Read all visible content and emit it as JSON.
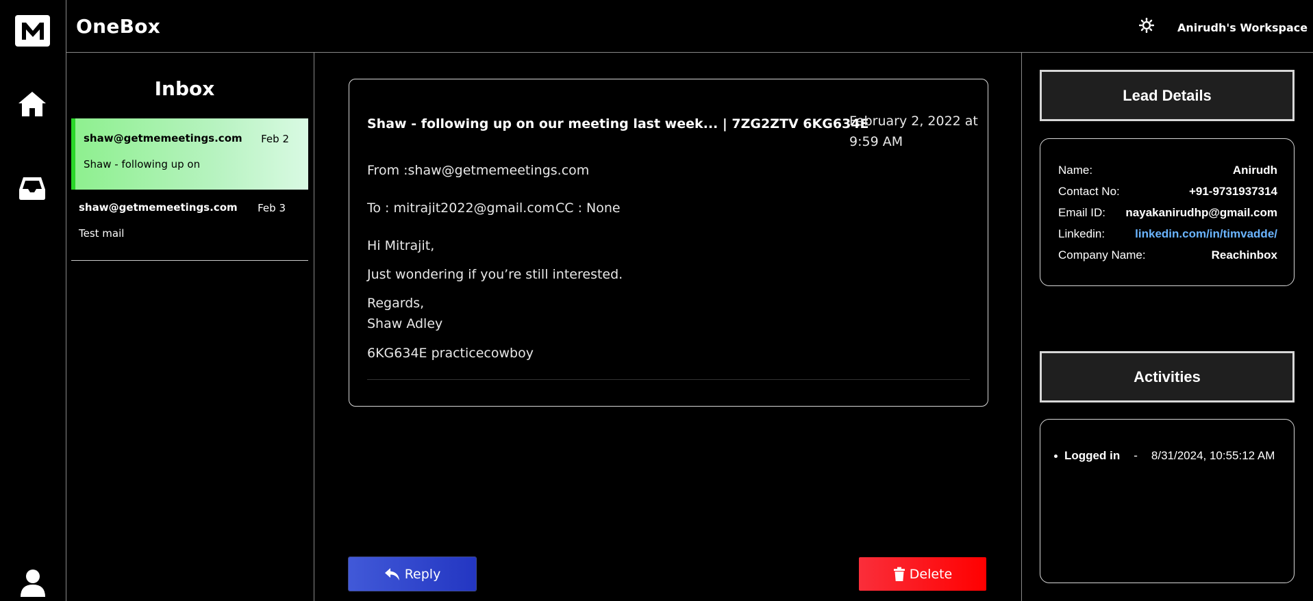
{
  "app": {
    "title": "OneBox",
    "workspace": "Anirudh's Workspace"
  },
  "colors": {
    "accent_green": "#2ad629",
    "reply_blue": "#2b3fc9",
    "delete_red": "#ff1a1a",
    "link_blue": "#6bb5ff"
  },
  "rail": {
    "icons": [
      "logo-m-icon",
      "home-icon",
      "inbox-tray-icon",
      "user-icon"
    ]
  },
  "inbox": {
    "heading": "Inbox",
    "items": [
      {
        "from": "shaw@getmemeetings.com",
        "date": "Feb 2",
        "subject": "Shaw - following up on"
      },
      {
        "from": "shaw@getmemeetings.com",
        "date": "Feb 3",
        "subject": "Test mail"
      }
    ]
  },
  "email": {
    "subject": "Shaw - following up on our meeting last week... | 7ZG2ZTV 6KG634E",
    "datetime": "February 2, 2022 at 9:59 AM",
    "from": "From :shaw@getmemeetings.com",
    "to": "To : mitrajit2022@gmail.com",
    "cc": "CC : None",
    "greeting": "Hi Mitrajit,",
    "body": "Just wondering if you’re still interested.",
    "regards": "Regards,",
    "signer": "Shaw Adley",
    "ps": "6KG634E practicecowboy"
  },
  "actions": {
    "reply": "Reply",
    "delete": "Delete"
  },
  "lead": {
    "heading": "Lead Details",
    "rows": [
      {
        "label": "Name:",
        "value": "Anirudh"
      },
      {
        "label": "Contact No:",
        "value": "+91-9731937314"
      },
      {
        "label": "Email ID:",
        "value": "nayakanirudhp@gmail.com"
      },
      {
        "label": "Linkedin:",
        "value": "linkedin.com/in/timvadde/"
      },
      {
        "label": "Company Name:",
        "value": "Reachinbox"
      }
    ]
  },
  "activities": {
    "heading": "Activities",
    "items": [
      {
        "name": "Logged in",
        "sep": "-",
        "time": "8/31/2024, 10:55:12 AM"
      }
    ]
  }
}
